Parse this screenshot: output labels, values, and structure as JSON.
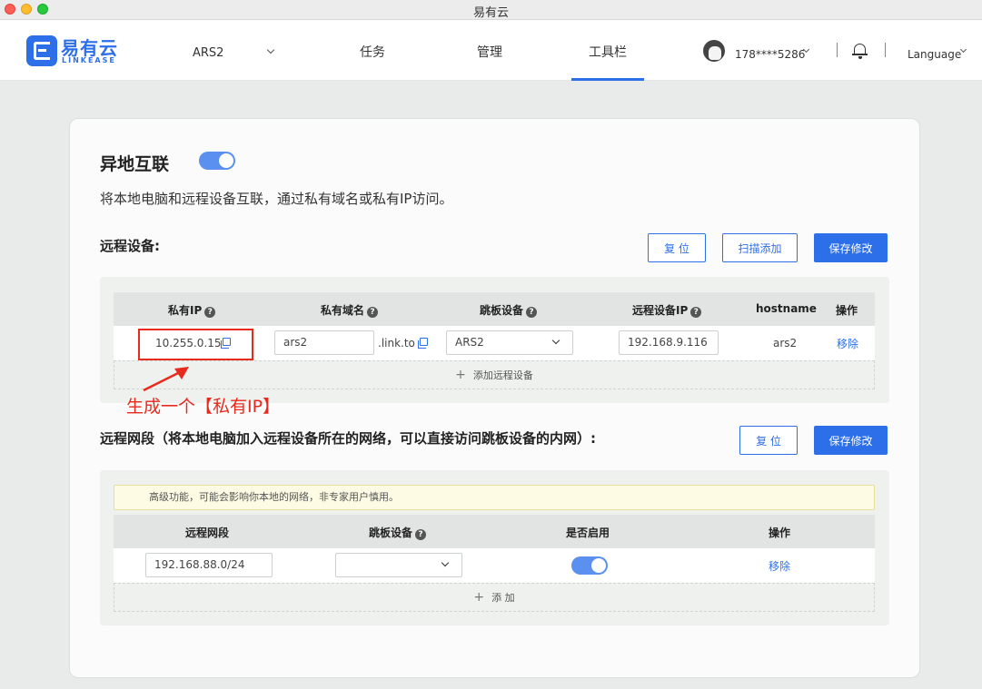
{
  "window": {
    "title": "易有云"
  },
  "nav": {
    "brand": "易有云",
    "brand_sub": "LINKEASE",
    "device": "ARS2",
    "items": [
      {
        "label": "任务"
      },
      {
        "label": "管理"
      },
      {
        "label": "工具栏"
      }
    ],
    "active": "工具栏",
    "phone": "178****5286",
    "language": "Language"
  },
  "remote_link": {
    "title": "异地互联",
    "enabled": true,
    "description": "将本地电脑和远程设备互联，通过私有域名或私有IP访问。"
  },
  "remote_devices": {
    "title": "远程设备:",
    "buttons": {
      "reset": "复 位",
      "scan_add": "扫描添加",
      "save": "保存修改"
    },
    "columns": [
      "私有IP",
      "私有域名",
      "跳板设备",
      "远程设备IP",
      "hostname",
      "操作"
    ],
    "rows": [
      {
        "private_ip": "10.255.0.15",
        "domain": "ars2",
        "domain_suffix": ".link.to",
        "jump_device": "ARS2",
        "remote_ip": "192.168.9.116",
        "hostname": "ars2",
        "action": "移除"
      }
    ],
    "add_label": "添加远程设备"
  },
  "annotation": {
    "text": "生成一个【私有IP】",
    "color": "#e62a1d"
  },
  "remote_segments": {
    "title": "远程网段（将本地电脑加入远程设备所在的网络，可以直接访问跳板设备的内网）:",
    "buttons": {
      "reset": "复 位",
      "save": "保存修改"
    },
    "warning": "高级功能，可能会影响你本地的网络，非专家用户慎用。",
    "columns": [
      "远程网段",
      "跳板设备",
      "是否启用",
      "操作"
    ],
    "rows": [
      {
        "segment": "192.168.88.0/24",
        "jump_device": "",
        "enabled": true,
        "action": "移除"
      }
    ],
    "add_label": "添 加"
  },
  "colors": {
    "accent": "#2d6fe8",
    "annotation": "#e62a1d"
  }
}
